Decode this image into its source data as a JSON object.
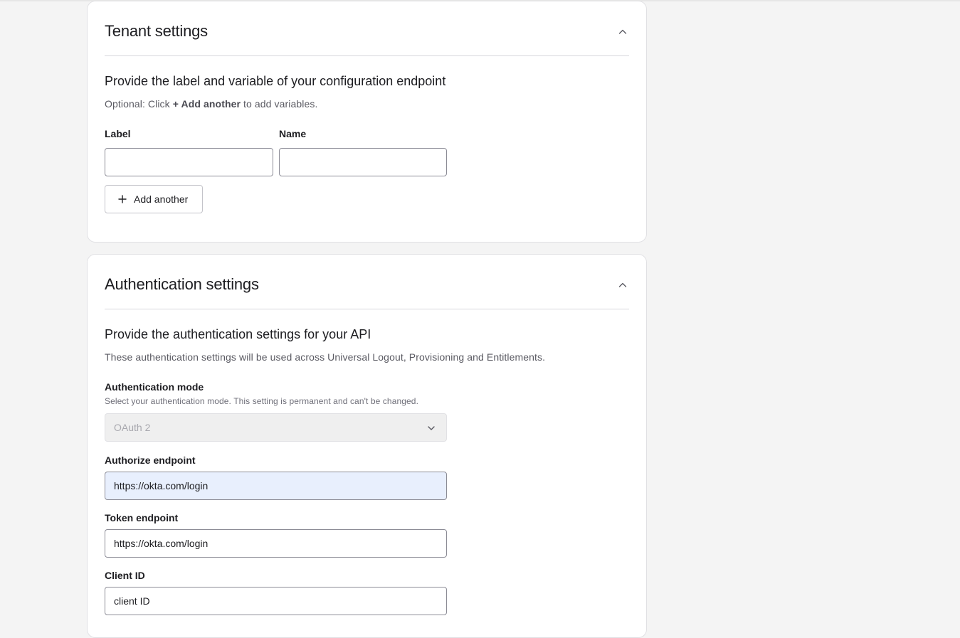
{
  "tenant_settings": {
    "title": "Tenant settings",
    "heading": "Provide the label and variable of your configuration endpoint",
    "description_prefix": "Optional: Click ",
    "description_emphasis": "+ Add another",
    "description_suffix": " to add variables.",
    "label_field": {
      "label": "Label",
      "value": ""
    },
    "name_field": {
      "label": "Name",
      "value": ""
    },
    "add_another_label": "Add another"
  },
  "authentication_settings": {
    "title": "Authentication settings",
    "heading": "Provide the authentication settings for your API",
    "description": "These authentication settings will be used across Universal Logout, Provisioning and Entitlements.",
    "auth_mode": {
      "label": "Authentication mode",
      "hint": "Select your authentication mode. This setting is permanent and can't be changed.",
      "selected": "OAuth 2"
    },
    "authorize_endpoint": {
      "label": "Authorize endpoint",
      "value": "https://okta.com/login"
    },
    "token_endpoint": {
      "label": "Token endpoint",
      "value": "https://okta.com/login"
    },
    "client_id": {
      "label": "Client ID",
      "value": "client ID"
    }
  },
  "icons": {
    "collapse": "chevron-up-icon",
    "select": "chevron-down-icon",
    "add": "plus-icon"
  },
  "colors": {
    "page_background": "#f4f4f4",
    "card_background": "#ffffff",
    "autofill_background": "#e8effd",
    "disabled_background": "#efefef"
  }
}
